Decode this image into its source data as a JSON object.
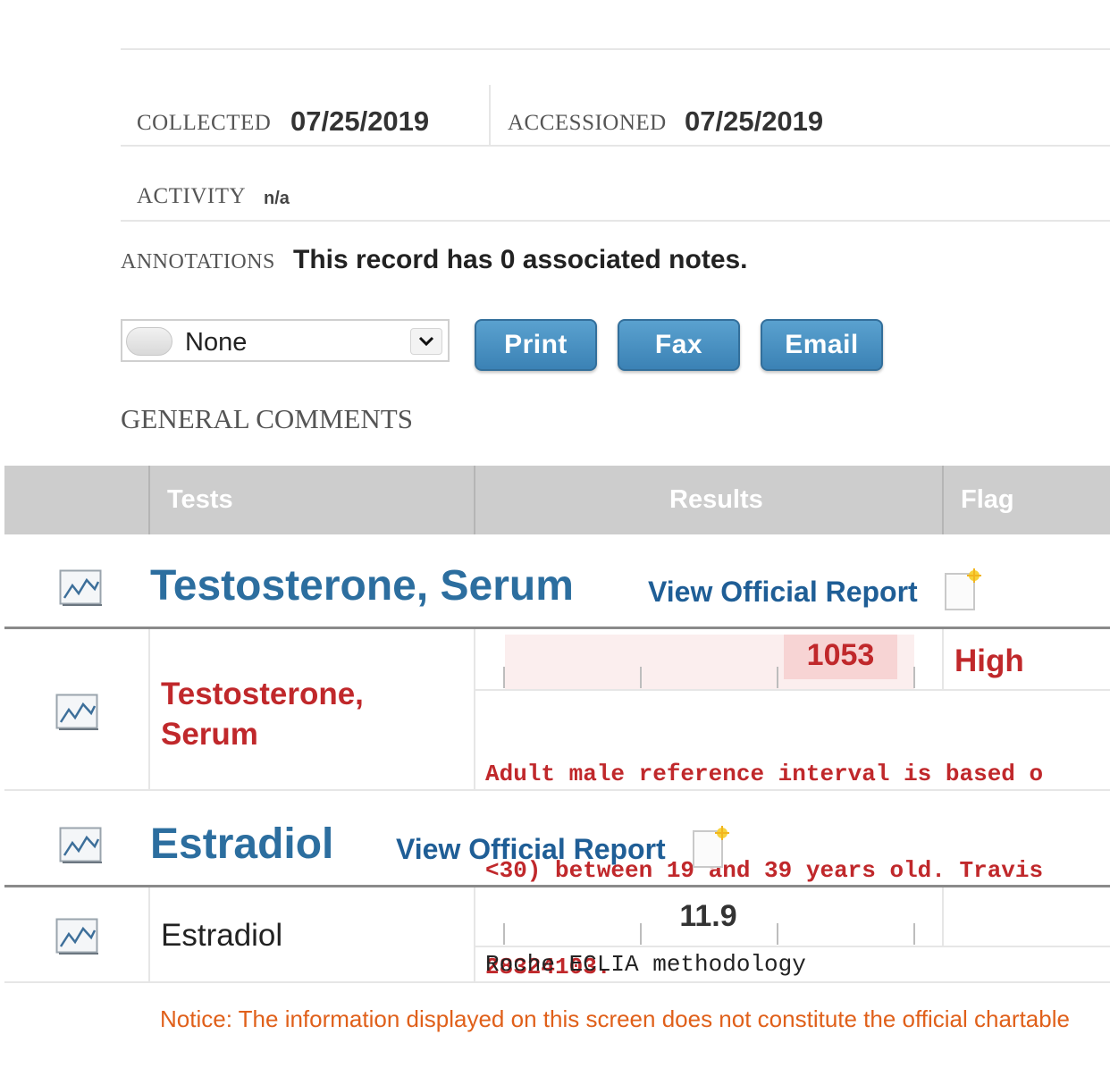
{
  "header": {
    "collected_label": "COLLECTED",
    "collected_value": "07/25/2019",
    "accessioned_label": "ACCESSIONED",
    "accessioned_value": "07/25/2019",
    "activity_label": "ACTIVITY",
    "activity_value": "n/a",
    "annotations_label": "ANNOTATIONS",
    "annotations_value": "This record has 0 associated notes."
  },
  "toolbar": {
    "select_value": "None",
    "print_label": "Print",
    "fax_label": "Fax",
    "email_label": "Email"
  },
  "general_comments_label": "GENERAL COMMENTS",
  "table": {
    "columns": [
      "Tests",
      "Results",
      "Flag"
    ]
  },
  "groups": [
    {
      "title": "Testosterone, Serum",
      "view_report": "View Official Report",
      "row": {
        "name_line1": "Testosterone,",
        "name_line2": "Serum",
        "value": "1053",
        "flag": "High",
        "comment_lines": [
          "Adult male reference interval is based o",
          "<30) between 19 and 39 years old. Travis",
          "28324103."
        ]
      }
    },
    {
      "title": "Estradiol",
      "view_report": "View Official Report",
      "row": {
        "name": "Estradiol",
        "value": "11.9",
        "flag": "",
        "comment": "Roche ECLIA methodology"
      }
    }
  ],
  "notice": "Notice: The information displayed on this screen does not constitute the official chartable",
  "colors": {
    "accent_blue": "#2c6e9f",
    "flag_red": "#c0282b",
    "notice_orange": "#e0601a",
    "button_blue": "#3b82b5"
  }
}
